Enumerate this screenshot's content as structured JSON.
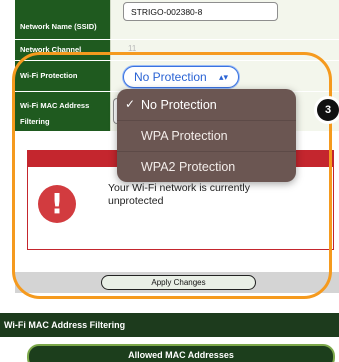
{
  "settings": {
    "ssid_label": "Network Name (SSID)",
    "ssid_value": "STRIGO-002380-8",
    "channel_label": "Network Channel",
    "channel_value": "11",
    "protection_label": "Wi-Fi Protection",
    "protection_value": "No Protection",
    "mac_label": "Wi-Fi MAC Address Filtering"
  },
  "dropdown": {
    "options": [
      {
        "label": "No Protection",
        "selected": true
      },
      {
        "label": "WPA Protection",
        "selected": false
      },
      {
        "label": "WPA2 Protection",
        "selected": false
      }
    ],
    "check_glyph": "✓"
  },
  "warning": {
    "icon_glyph": "!",
    "message": "Your Wi-Fi network is currently unprotected"
  },
  "apply": {
    "label": "Apply Changes"
  },
  "mac_section": {
    "title": "Wi-Fi MAC Address Filtering",
    "allowed_label": "Allowed MAC Addresses"
  },
  "annotation": {
    "step_number": "3"
  },
  "colors": {
    "label_green": "#1f5a1f",
    "warning_red": "#c4262e",
    "annotation_orange": "#f59a1e",
    "select_blue": "#2a63d4"
  }
}
